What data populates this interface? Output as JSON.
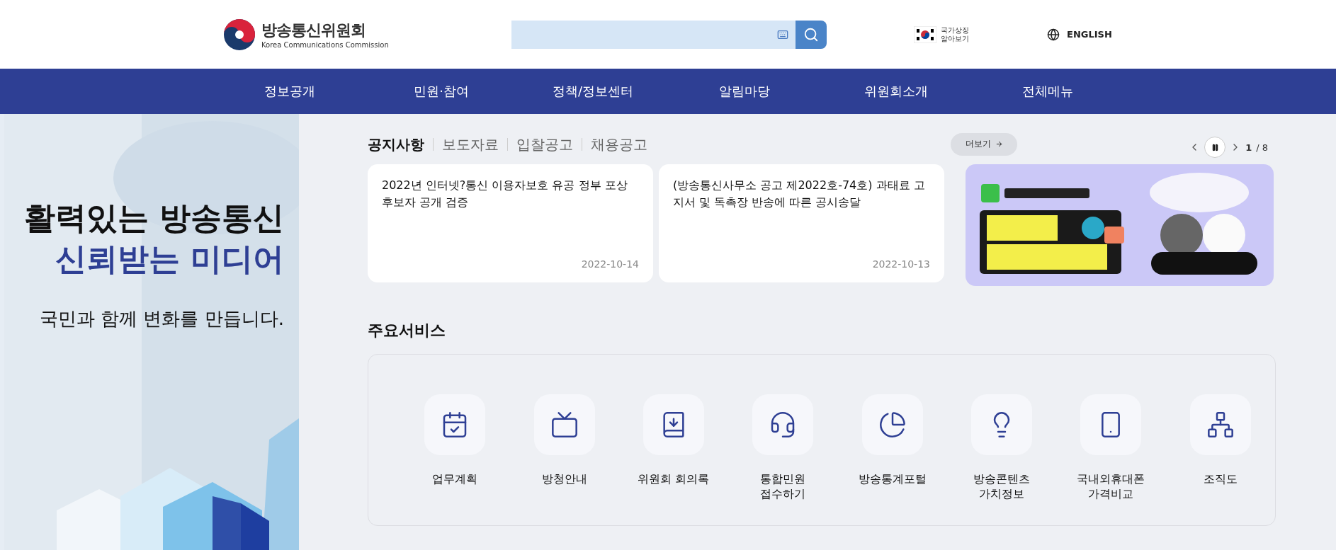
{
  "header": {
    "logo": {
      "name": "방송통신위원회",
      "subtitle": "Korea Communications Commission"
    },
    "national_symbol": [
      "국가상징",
      "알아보기"
    ],
    "language": "ENGLISH"
  },
  "nav": [
    "정보공개",
    "민원·참여",
    "정책/정보센터",
    "알림마당",
    "위원회소개",
    "전체메뉴"
  ],
  "hero": {
    "headline": "활력있는 방송통신",
    "headline_accent": "신뢰받는 미디어",
    "tagline": "국민과 함께 변화를 만듭니다."
  },
  "notices": {
    "tabs": [
      {
        "label": "공지사항",
        "selected": true
      },
      {
        "label": "보도자료",
        "selected": false
      },
      {
        "label": "입찰공고",
        "selected": false
      },
      {
        "label": "채용공고",
        "selected": false
      }
    ],
    "more": "더보기",
    "pager": {
      "current": "1",
      "total": "/ 8"
    },
    "cards": [
      {
        "title": "2022년 인터넷?통신 이용자보호 유공 정부 포상 후보자 공개 검증",
        "date": "2022-10-14"
      },
      {
        "title": "(방송통신사무소 공고 제2022호-74호) 과태료 고지서 및 독촉장 반송에 따른 공시송달",
        "date": "2022-10-13"
      }
    ]
  },
  "services": {
    "title": "주요서비스",
    "items": [
      {
        "label": "업무계획"
      },
      {
        "label": "방청안내"
      },
      {
        "label": "위원회 회의록"
      },
      {
        "label": "통합민원\n접수하기"
      },
      {
        "label": "방송통계포털"
      },
      {
        "label": "방송콘텐츠\n가치정보"
      },
      {
        "label": "국내외휴대폰\n가격비교"
      },
      {
        "label": "조직도"
      }
    ]
  }
}
